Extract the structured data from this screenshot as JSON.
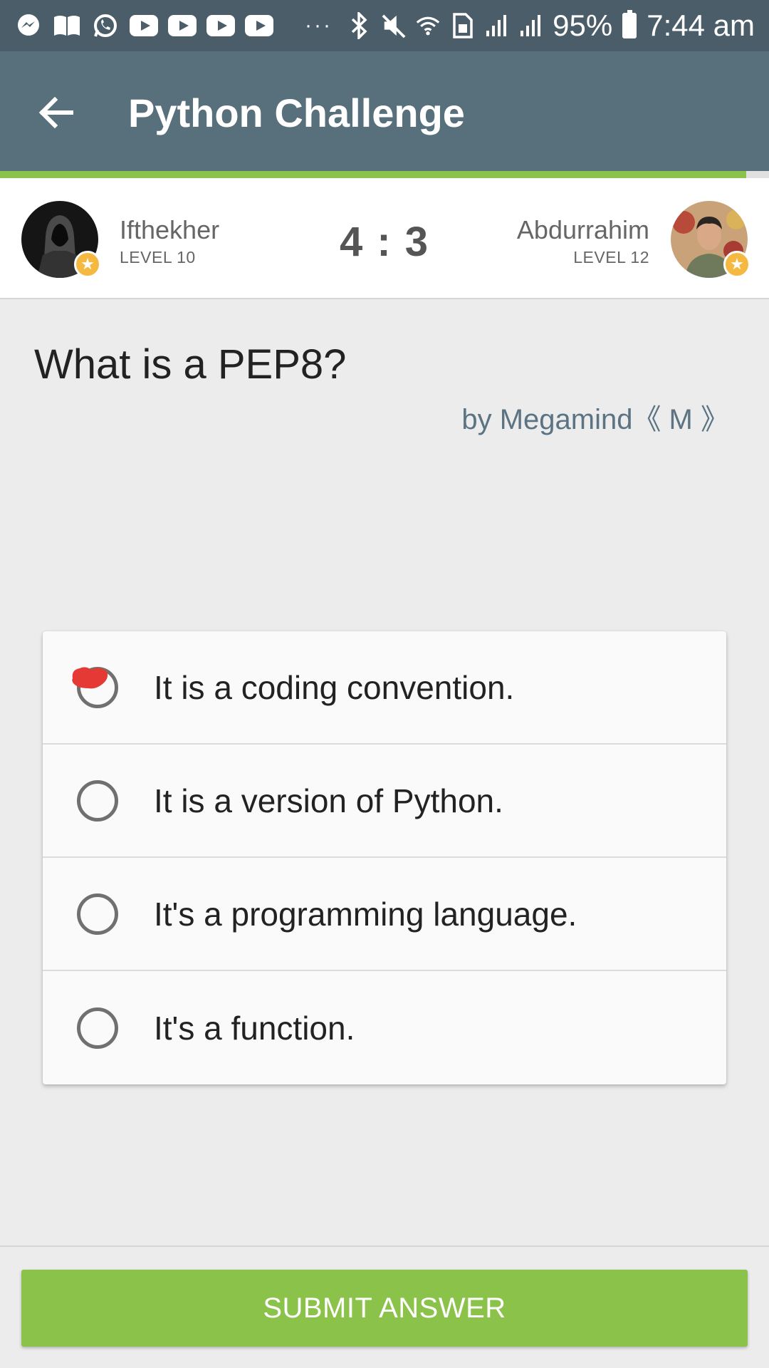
{
  "status_bar": {
    "app_icons": [
      "messenger-icon",
      "book-icon",
      "whatsapp-icon",
      "youtube-icon",
      "youtube-icon",
      "youtube-icon",
      "youtube-icon"
    ],
    "overflow": "···",
    "battery": "95%",
    "time": "7:44 am"
  },
  "app_bar": {
    "title": "Python Challenge",
    "progress": 0.97
  },
  "players": {
    "left": {
      "name": "Ifthekher",
      "level": "LEVEL 10"
    },
    "right": {
      "name": "Abdurrahim",
      "level": "LEVEL 12"
    },
    "score": "4 : 3"
  },
  "question": {
    "text": "What is a PEP8?",
    "author": "by Megamind《 M 》"
  },
  "answers": [
    {
      "text": "It is a coding convention.",
      "marked": true
    },
    {
      "text": "It is a version of Python.",
      "marked": false
    },
    {
      "text": "It's a programming language.",
      "marked": false
    },
    {
      "text": "It's a function.",
      "marked": false
    }
  ],
  "submit": {
    "label": "SUBMIT ANSWER"
  },
  "colors": {
    "status_bar": "#4a5d69",
    "app_bar": "#586f7c",
    "accent_green": "#8bc34a",
    "mark_red": "#e53935",
    "author_text": "#5b7382"
  }
}
